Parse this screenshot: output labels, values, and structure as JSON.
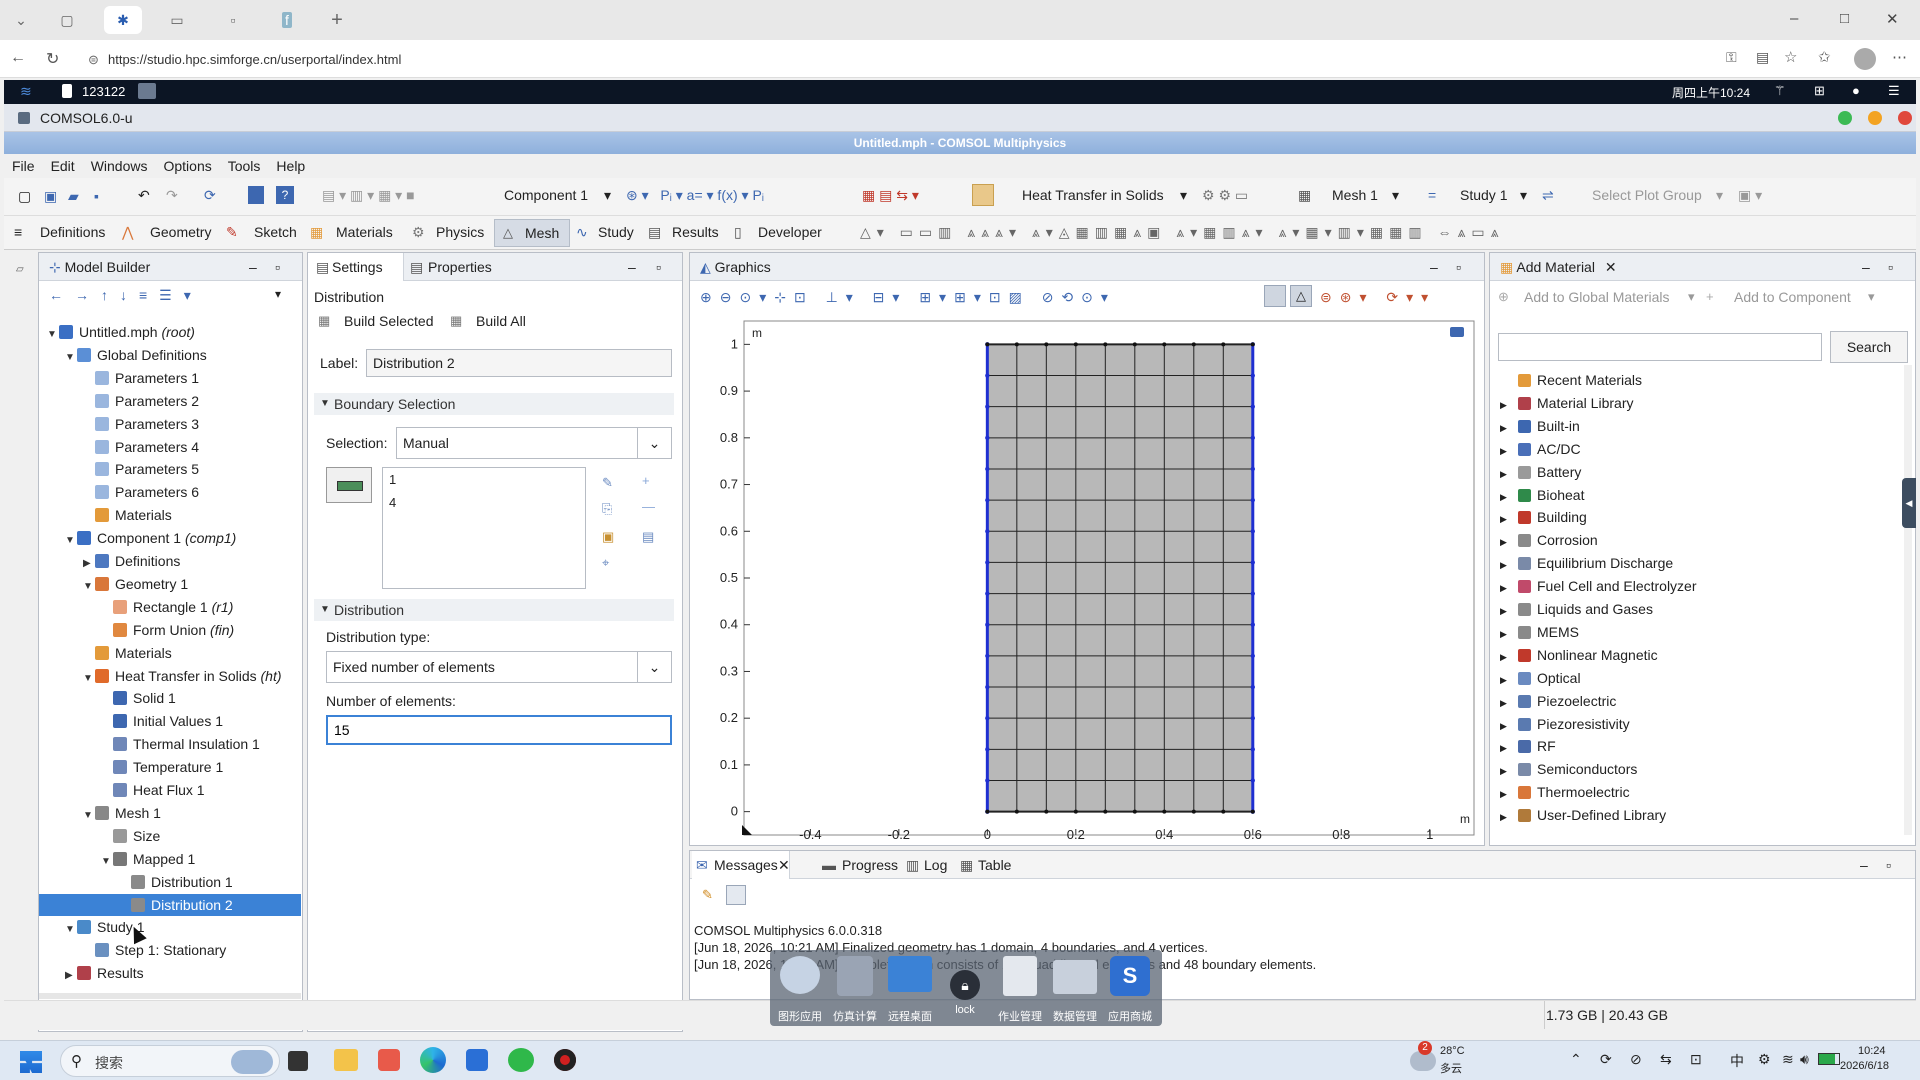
{
  "browser": {
    "url": "https://studio.hpc.simforge.cn/userportal/index.html",
    "window_controls": [
      "–",
      "□",
      "✕"
    ]
  },
  "portal": {
    "session_id": "123122",
    "datetime": "周四上午10:24"
  },
  "comsol_window": {
    "title": "COMSOL6.0-u",
    "app_title": "Untitled.mph - COMSOL Multiphysics"
  },
  "menu": [
    "File",
    "Edit",
    "Windows",
    "Options",
    "Tools",
    "Help"
  ],
  "quick_toolbar": {
    "component": "Component 1",
    "physics": "Heat Transfer in Solids",
    "mesh": "Mesh 1",
    "study": "Study 1",
    "plot_group": "Select Plot Group"
  },
  "ribbon_tabs": [
    "Definitions",
    "Geometry",
    "Sketch",
    "Materials",
    "Physics",
    "Mesh",
    "Study",
    "Results",
    "Developer"
  ],
  "ribbon_active": "Mesh",
  "model_builder": {
    "title": "Model Builder",
    "tree": [
      {
        "label": "Untitled.mph",
        "suffix": "(root)",
        "depth": 0,
        "toggle": "▼",
        "icon": "#3b6fc4"
      },
      {
        "label": "Global Definitions",
        "suffix": "",
        "depth": 1,
        "toggle": "▼",
        "icon": "#5b8fd6"
      },
      {
        "label": "Parameters 1",
        "suffix": "",
        "depth": 2,
        "toggle": "",
        "icon": "#9ab6de"
      },
      {
        "label": "Parameters 2",
        "suffix": "",
        "depth": 2,
        "toggle": "",
        "icon": "#9ab6de"
      },
      {
        "label": "Parameters 3",
        "suffix": "",
        "depth": 2,
        "toggle": "",
        "icon": "#9ab6de"
      },
      {
        "label": "Parameters 4",
        "suffix": "",
        "depth": 2,
        "toggle": "",
        "icon": "#9ab6de"
      },
      {
        "label": "Parameters 5",
        "suffix": "",
        "depth": 2,
        "toggle": "",
        "icon": "#9ab6de"
      },
      {
        "label": "Parameters 6",
        "suffix": "",
        "depth": 2,
        "toggle": "",
        "icon": "#9ab6de"
      },
      {
        "label": "Materials",
        "suffix": "",
        "depth": 2,
        "toggle": "",
        "icon": "#e39a3a"
      },
      {
        "label": "Component 1",
        "suffix": "(comp1)",
        "depth": 1,
        "toggle": "▼",
        "icon": "#3b6fc4"
      },
      {
        "label": "Definitions",
        "suffix": "",
        "depth": 2,
        "toggle": "▶",
        "icon": "#4d78c0"
      },
      {
        "label": "Geometry 1",
        "suffix": "",
        "depth": 2,
        "toggle": "▼",
        "icon": "#d9773a"
      },
      {
        "label": "Rectangle 1",
        "suffix": "(r1)",
        "depth": 3,
        "toggle": "",
        "icon": "#e8a07a"
      },
      {
        "label": "Form Union",
        "suffix": "(fin)",
        "depth": 3,
        "toggle": "",
        "icon": "#e0883f"
      },
      {
        "label": "Materials",
        "suffix": "",
        "depth": 2,
        "toggle": "",
        "icon": "#e39a3a"
      },
      {
        "label": "Heat Transfer in Solids",
        "suffix": "(ht)",
        "depth": 2,
        "toggle": "▼",
        "icon": "#e06a2a"
      },
      {
        "label": "Solid 1",
        "suffix": "",
        "depth": 3,
        "toggle": "",
        "icon": "#3d67b0"
      },
      {
        "label": "Initial Values 1",
        "suffix": "",
        "depth": 3,
        "toggle": "",
        "icon": "#3d67b0"
      },
      {
        "label": "Thermal Insulation 1",
        "suffix": "",
        "depth": 3,
        "toggle": "",
        "icon": "#6f87b8"
      },
      {
        "label": "Temperature 1",
        "suffix": "",
        "depth": 3,
        "toggle": "",
        "icon": "#6f87b8"
      },
      {
        "label": "Heat Flux 1",
        "suffix": "",
        "depth": 3,
        "toggle": "",
        "icon": "#6f87b8"
      },
      {
        "label": "Mesh 1",
        "suffix": "",
        "depth": 2,
        "toggle": "▼",
        "icon": "#888888"
      },
      {
        "label": "Size",
        "suffix": "",
        "depth": 3,
        "toggle": "",
        "icon": "#999999"
      },
      {
        "label": "Mapped 1",
        "suffix": "",
        "depth": 3,
        "toggle": "▼",
        "icon": "#777777"
      },
      {
        "label": "Distribution 1",
        "suffix": "",
        "depth": 4,
        "toggle": "",
        "icon": "#8a8a8a"
      },
      {
        "label": "Distribution 2",
        "suffix": "",
        "depth": 4,
        "toggle": "",
        "icon": "#8a8a8a",
        "selected": true
      },
      {
        "label": "Study 1",
        "suffix": "",
        "depth": 1,
        "toggle": "▼",
        "icon": "#4a8ac9"
      },
      {
        "label": "Step 1: Stationary",
        "suffix": "",
        "depth": 2,
        "toggle": "",
        "icon": "#6a90c0"
      },
      {
        "label": "Results",
        "suffix": "",
        "depth": 1,
        "toggle": "▶",
        "icon": "#b0404a"
      }
    ]
  },
  "settings": {
    "tab_settings": "Settings",
    "tab_properties": "Properties",
    "node_type": "Distribution",
    "build_selected": "Build Selected",
    "build_all": "Build All",
    "label_caption": "Label:",
    "label_value": "Distribution 2",
    "boundary_section": "Boundary Selection",
    "selection_caption": "Selection:",
    "selection_value": "Manual",
    "selected_boundaries": [
      "1",
      "4"
    ],
    "distribution_section": "Distribution",
    "dist_type_caption": "Distribution type:",
    "dist_type_value": "Fixed number of elements",
    "num_elements_caption": "Number of elements:",
    "num_elements_value": "15"
  },
  "graphics": {
    "title": "Graphics",
    "y_unit": "m",
    "x_unit": "m"
  },
  "chart_data": {
    "type": "scatter",
    "title": "",
    "xlabel": "m",
    "ylabel": "m",
    "xlim": [
      -0.55,
      1.1
    ],
    "ylim": [
      -0.05,
      1.05
    ],
    "x_ticks": [
      -0.4,
      -0.2,
      0,
      0.2,
      0.4,
      0.6,
      0.8,
      1
    ],
    "y_ticks": [
      0,
      0.1,
      0.2,
      0.3,
      0.4,
      0.5,
      0.6,
      0.7,
      0.8,
      0.9,
      1
    ],
    "mesh_rect": {
      "x0": 0,
      "x1": 0.6,
      "y0": 0,
      "y1": 1
    },
    "mesh_cols": 9,
    "mesh_rows": 15,
    "highlighted_boundaries": [
      "left",
      "right"
    ],
    "colors": {
      "fill": "#b8b8b8",
      "grid": "#222222",
      "highlight": "#1e2fd1"
    }
  },
  "add_material": {
    "title": "Add Material",
    "add_global": "Add to Global Materials",
    "add_component": "Add to Component",
    "search_button": "Search",
    "search_value": "",
    "items": [
      {
        "label": "Recent Materials",
        "icon": "#e39a3a",
        "toggle": ""
      },
      {
        "label": "Material Library",
        "icon": "#b0404a",
        "toggle": "▶"
      },
      {
        "label": "Built-in",
        "icon": "#3d67b0",
        "toggle": "▶"
      },
      {
        "label": "AC/DC",
        "icon": "#4a6fb8",
        "toggle": "▶"
      },
      {
        "label": "Battery",
        "icon": "#9a9a9a",
        "toggle": "▶"
      },
      {
        "label": "Bioheat",
        "icon": "#2f8a4a",
        "toggle": "▶"
      },
      {
        "label": "Building",
        "icon": "#c0392b",
        "toggle": "▶"
      },
      {
        "label": "Corrosion",
        "icon": "#8a8a8a",
        "toggle": "▶"
      },
      {
        "label": "Equilibrium Discharge",
        "icon": "#7a8aa8",
        "toggle": "▶"
      },
      {
        "label": "Fuel Cell and Electrolyzer",
        "icon": "#c04a6a",
        "toggle": "▶"
      },
      {
        "label": "Liquids and Gases",
        "icon": "#8a8a8a",
        "toggle": "▶"
      },
      {
        "label": "MEMS",
        "icon": "#8a8a8a",
        "toggle": "▶"
      },
      {
        "label": "Nonlinear Magnetic",
        "icon": "#c0392b",
        "toggle": "▶"
      },
      {
        "label": "Optical",
        "icon": "#6a8ac0",
        "toggle": "▶"
      },
      {
        "label": "Piezoelectric",
        "icon": "#5a7ab0",
        "toggle": "▶"
      },
      {
        "label": "Piezoresistivity",
        "icon": "#5a7ab0",
        "toggle": "▶"
      },
      {
        "label": "RF",
        "icon": "#4a6aa8",
        "toggle": "▶"
      },
      {
        "label": "Semiconductors",
        "icon": "#7a8aa8",
        "toggle": "▶"
      },
      {
        "label": "Thermoelectric",
        "icon": "#d9773a",
        "toggle": "▶"
      },
      {
        "label": "User-Defined Library",
        "icon": "#b07a3a",
        "toggle": "▶"
      }
    ]
  },
  "messages": {
    "tabs": [
      "Messages",
      "Progress",
      "Log",
      "Table"
    ],
    "lines": [
      "COMSOL Multiphysics 6.0.0.318",
      "[Jun 18, 2026, 10:21 AM] Finalized geometry has 1 domain, 4 boundaries, and 4 vertices.",
      "[Jun 18, 2026, 10:21 AM] Complete mesh consists of 135 quadrilateral elements and 48 boundary elements."
    ]
  },
  "status": {
    "memory": "1.73 GB | 20.43 GB"
  },
  "dock": [
    {
      "label": "图形应用"
    },
    {
      "label": "仿真计算"
    },
    {
      "label": "远程桌面"
    },
    {
      "label": "lock"
    },
    {
      "label": "作业管理"
    },
    {
      "label": "数据管理"
    },
    {
      "label": "应用商城"
    }
  ],
  "taskbar": {
    "search_placeholder": "搜索",
    "weather_temp": "28°C",
    "weather_desc": "多云",
    "weather_badge": "2",
    "ime": "中",
    "time": "10:24",
    "date": "2026/6/18"
  }
}
